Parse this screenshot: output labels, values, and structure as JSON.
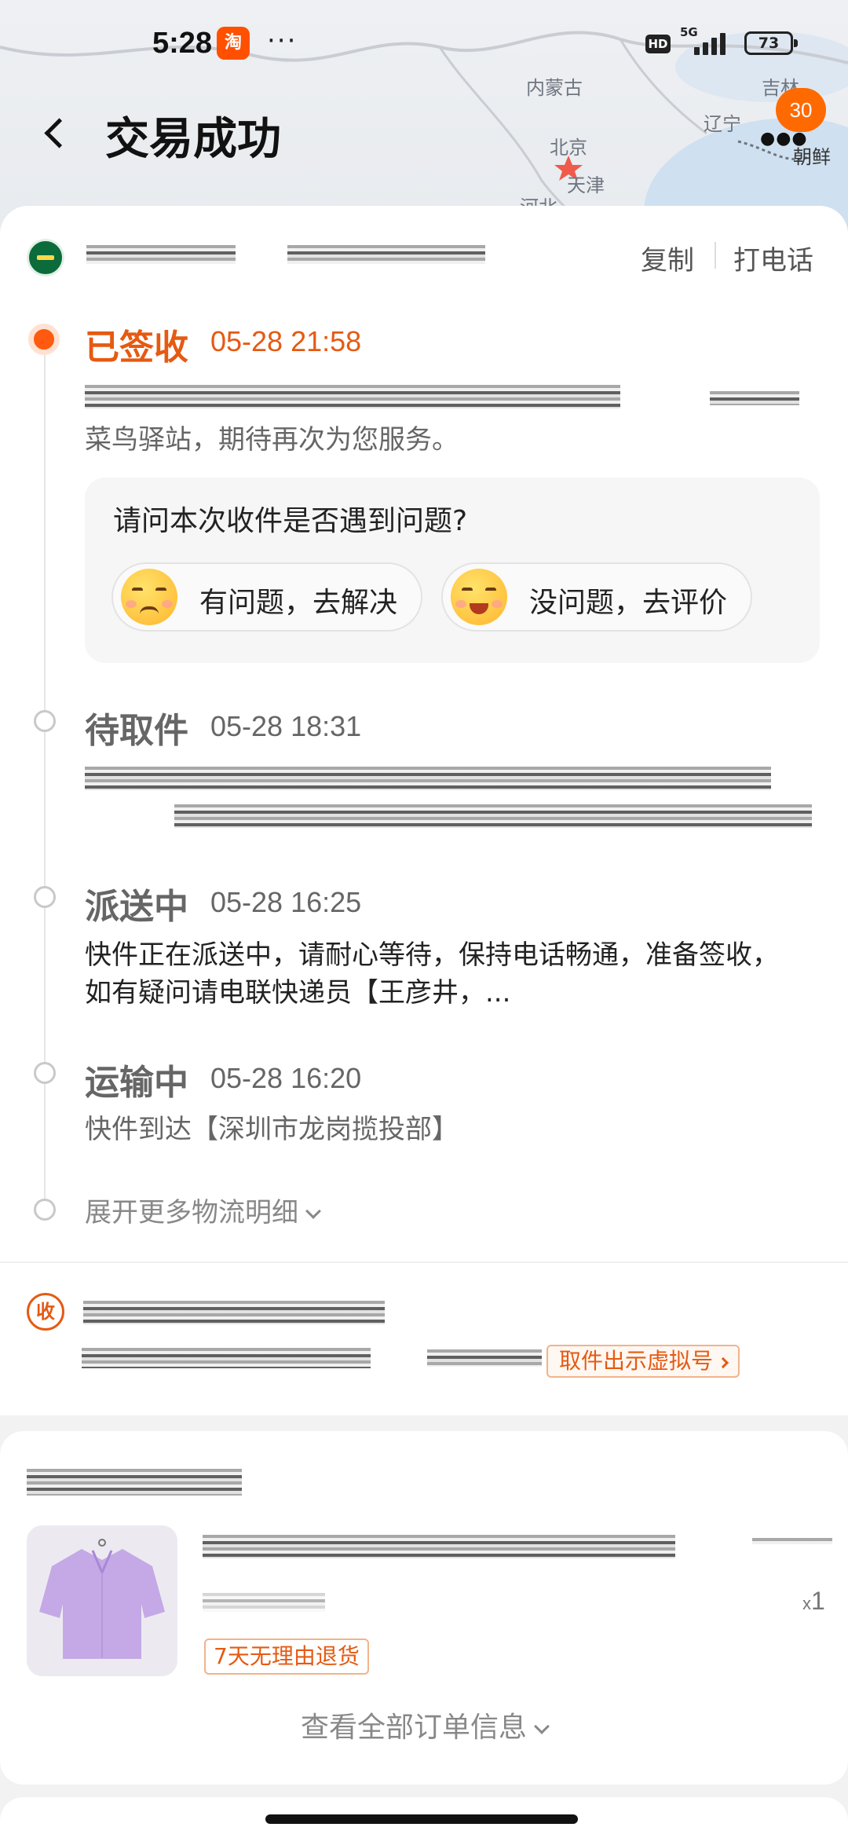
{
  "status_bar": {
    "time": "5:28",
    "app_badge": "淘",
    "more_dots": "···",
    "hd_label": "HD",
    "network": "5G",
    "battery": "73"
  },
  "map": {
    "labels": [
      "内蒙古",
      "吉林",
      "辽宁",
      "北京",
      "天津",
      "河北",
      "朝鲜"
    ],
    "badge_count": "30"
  },
  "header": {
    "title": "交易成功"
  },
  "logistics": {
    "copy_label": "复制",
    "call_label": "打电话",
    "events": [
      {
        "status": "已签收",
        "time": "05-28 21:58",
        "desc": "菜鸟驿站，期待再次为您服务。",
        "active": true
      },
      {
        "status": "待取件",
        "time": "05-28 18:31",
        "desc": ""
      },
      {
        "status": "派送中",
        "time": "05-28 16:25",
        "desc": "快件正在派送中，请耐心等待，保持电话畅通，准备签收，如有疑问请电联快递员【王彦井，..."
      },
      {
        "status": "运输中",
        "time": "05-28 16:20",
        "desc": "快件到达【深圳市龙岗揽投部】"
      }
    ],
    "feedback": {
      "question": "请问本次收件是否遇到问题?",
      "problem_label": "有问题，去解决",
      "ok_label": "没问题，去评价"
    },
    "expand_label": "展开更多物流明细"
  },
  "recipient": {
    "icon_label": "收",
    "pickup_code_label": "取件出示虚拟号"
  },
  "order": {
    "quantity_prefix": "x",
    "quantity": "1",
    "return_tag": "7天无理由退货",
    "view_all_label": "查看全部订单信息"
  }
}
